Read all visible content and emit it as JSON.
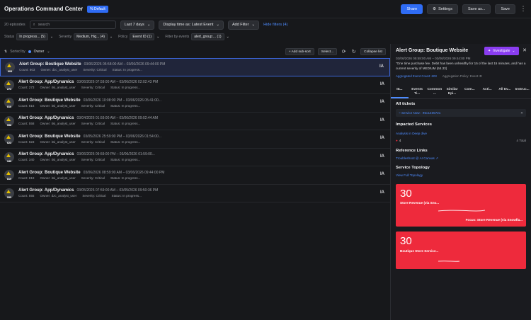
{
  "header": {
    "title": "Operations Command Center",
    "badge": "% Default",
    "share": "Share",
    "settings": "Settings",
    "save_as": "Save as...",
    "save": "Save"
  },
  "filters": {
    "episodes_count": "20 episodes",
    "search_placeholder": "search",
    "time_range": "Last 7 days",
    "display_time": "Display time as: Latest Event",
    "add_filter": "Add Filter",
    "hide_filters": "Hide filters (4)",
    "status_label": "Status",
    "status_value": "In progress... (5)",
    "severity_label": "Severity",
    "severity_value": "Medium, Hig... (4)",
    "policy_label": "Policy",
    "policy_value": "Event ID (1)",
    "filter_by_label": "Filter by events",
    "filter_by_value": "alert_group:... (1)"
  },
  "list_header": {
    "sorted_by": "Sorted by",
    "owner": "Owner",
    "add_sub_sort": "+ Add sub-sort",
    "select": "Select...",
    "collapse": "Collapse list"
  },
  "episodes": [
    {
      "count_badge": "603",
      "name": "Alert Group: Boutique Website",
      "dates": "03/06/2026 05:58:00 AM – 03/06/2026 09:44:00 PM",
      "count": "Count: 603",
      "owner": "Owner: dzc_analyst_user",
      "severity": "Severity: Critical",
      "status": "Status: In progress...",
      "initials": "IA"
    },
    {
      "count_badge": "273",
      "name": "Alert Group: App/Dynamics",
      "dates": "03/06/2026 07:59:00 AM – 03/06/2026 02:02:43 PM",
      "count": "Count: 273",
      "owner": "Owner: itsi_analyst_user",
      "severity": "Severity: Critical",
      "status": "Status: In progress...",
      "initials": "IA"
    },
    {
      "count_badge": "816",
      "name": "Alert Group: Boutique Website",
      "dates": "03/06/2026 10:08:00 PM – 03/06/2026 05:41:00...",
      "count": "Count: 816",
      "owner": "Owner: itsi_analyst_user",
      "severity": "Severity: Critical",
      "status": "Status: In progress...",
      "initials": "IA"
    },
    {
      "count_badge": "558",
      "name": "Alert Group: App/Dynamics",
      "dates": "03/04/2026 01:59:00 AM – 03/06/2026 09:02:44 AM",
      "count": "Count: 558",
      "owner": "Owner: itsi_analyst_user",
      "severity": "Severity: Critical",
      "status": "Status: In progress...",
      "initials": "IA"
    },
    {
      "count_badge": "623",
      "name": "Alert Group: Boutique Website",
      "dates": "03/05/2026 25:59:00 PM – 03/06/2026 01:54:00...",
      "count": "Count: 623",
      "owner": "Owner: itsi_analyst_user",
      "severity": "Severity: Critical",
      "status": "Status: In progress...",
      "initials": "IA"
    },
    {
      "count_badge": "340",
      "name": "Alert Group: App/Dynamics",
      "dates": "03/06/2026 09:59:00 PM – 03/06/2026 01:59:00...",
      "count": "Count: 340",
      "owner": "Owner: itsi_analyst_user",
      "severity": "Severity: Critical",
      "status": "Status: In progress...",
      "initials": "IA"
    },
    {
      "count_badge": "819",
      "name": "Alert Group: Boutique Website",
      "dates": "03/06/2026 08:59:00 AM – 03/06/2026 09:44:00 PM",
      "count": "Count: 819",
      "owner": "Owner: itsi_analyst_user",
      "severity": "Severity: Critical",
      "status": "Status: In progress...",
      "initials": "IA"
    },
    {
      "count_badge": "555",
      "name": "Alert Group: App/Dynamics",
      "dates": "03/05/2026 07:59:00 AM – 03/05/2026 09:50:36 PM",
      "count": "Count: 555",
      "owner": "Owner: dzc_analyst_user",
      "severity": "Severity: Critical",
      "status": "Status: In progress...",
      "initials": "IA"
    }
  ],
  "panel": {
    "title": "Alert Group: Boutique Website",
    "investigate": "Investigate",
    "dates": "03/06/2026 05:58:00 AM – 03/06/2026 09:44:00 PM",
    "description": "\"One time purchase fee. Debit has been unhealthy for 15 of the last 15 minutes, and has a current severity of MEDIUM (64.33)",
    "meta_link": "Aggregated Event Count: 603",
    "meta_policy": "Aggregation Policy: Event ID",
    "tabs": [
      "In...",
      "Events Ti...",
      "Common ...",
      "Similar Epi...",
      "Com...",
      "Acti...",
      "All Ev...",
      "Instruc..."
    ],
    "all_tickets": "All tickets",
    "ticket_text": "~ Service Now : INC1405721",
    "impacted_services": "Impacted Services",
    "analysis_link": "Analysis in Deep dive",
    "svc_count": "4",
    "svc_total": "4 Total",
    "reference_links": "Reference Links",
    "ref_link": "Troubleshoot @ AI Canvas ↗",
    "service_topology": "Service Topology",
    "topology_link": "View Full Topology",
    "cards": [
      {
        "value": "30",
        "label": "Store Revenue (via Sno...",
        "label2": "Focus: Store Revenue (via Snowfla..."
      },
      {
        "value": "30",
        "label": "Boutique Store Service...",
        "label2": ""
      }
    ]
  },
  "colors": {
    "accent": "#2f6cf5",
    "investigate": "#8a3df0",
    "critical_card": "#ee2a3c",
    "warning_icon": "#e6c000"
  }
}
